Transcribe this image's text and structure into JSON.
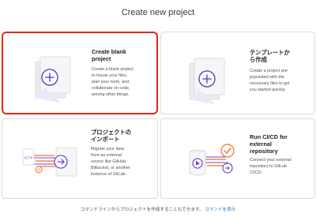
{
  "page": {
    "title": "Create new project"
  },
  "cards": [
    {
      "title_lines": [
        "Create blank",
        "project"
      ],
      "description_lines": [
        "Create a blank project",
        "to house your files,",
        "plan your work, and",
        "collaborate on code,",
        "among other things."
      ],
      "selected": true
    },
    {
      "title_lines": [
        "テンプレートか",
        "ら作成"
      ],
      "description_lines": [
        "Create a project pre-",
        "populated with the",
        "necessary files to get",
        "you started quickly."
      ],
      "selected": false
    },
    {
      "title_lines": [
        "プロジェクトの",
        "インポート"
      ],
      "description_lines": [
        "Migrate your data",
        "from an external",
        "source like GitHub,",
        "Bitbucket, or another",
        "instance of GitLab."
      ],
      "selected": false
    },
    {
      "title_lines": [
        "Run CI/CD for",
        "external",
        "repository"
      ],
      "description_lines": [
        "Connect your external",
        "repository to GitLab",
        "CI/CD."
      ],
      "selected": false
    }
  ],
  "footer": {
    "text": "コマンドラインからプロジェクトを作成することもできます。",
    "link_label": "コマンドを表示"
  },
  "icons": [
    "new-project-icon",
    "template-icon",
    "import-icon",
    "ci-cd-icon"
  ],
  "colors": {
    "accent": "#6e49cb",
    "selected_border": "#dd2b0e",
    "link": "#1f75cb"
  }
}
